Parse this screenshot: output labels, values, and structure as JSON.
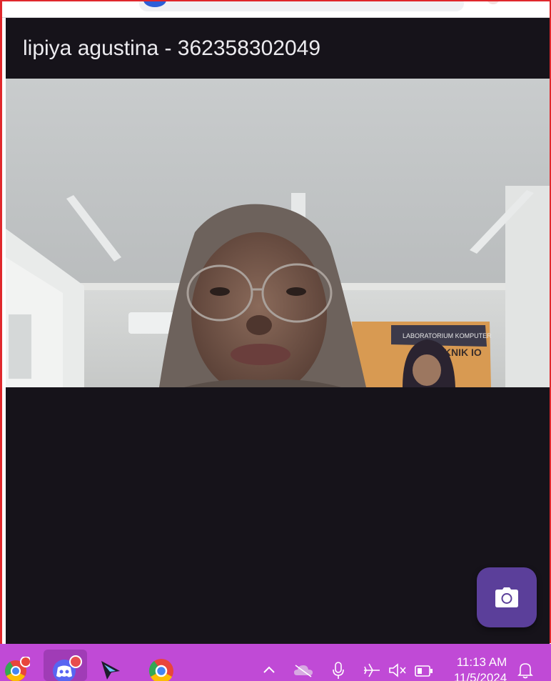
{
  "app": {
    "title": "lipiya agustina - 362358302049",
    "background": "#16131a",
    "accent": "#5b3f9a",
    "camera_preview": {
      "description": "live camera view",
      "poster_text_1": "LABORATORIUM KOMPUTER",
      "poster_text_2": "TEKNIK IO"
    },
    "capture_button": {
      "icon": "camera-icon"
    }
  },
  "taskbar": {
    "color": "#c04ad6",
    "apps": [
      {
        "name": "chrome-profile-icon"
      },
      {
        "name": "discord-icon"
      },
      {
        "name": "cursor-app-icon"
      },
      {
        "name": "chrome-icon"
      }
    ],
    "tray": {
      "icons": [
        "chevron-up-icon",
        "onedrive-icon",
        "microphone-icon",
        "airplane-mode-icon",
        "speaker-muted-icon",
        "battery-icon",
        "notification-bell-icon"
      ],
      "time": "11:13 AM",
      "date": "11/5/2024"
    }
  }
}
